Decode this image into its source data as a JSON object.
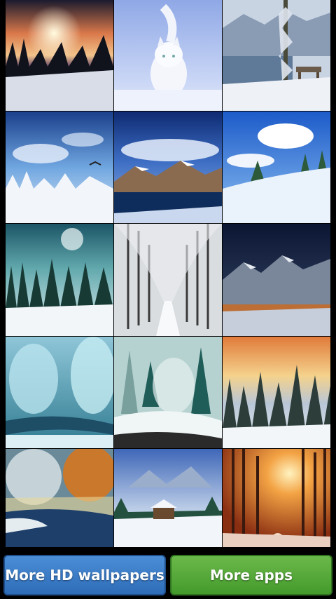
{
  "gallery": {
    "tiles": [
      {
        "subject": "winter-sunset-forest"
      },
      {
        "subject": "white-cat-in-snow"
      },
      {
        "subject": "lake-bench-snowy-trees"
      },
      {
        "subject": "snowy-forest-blue-sky-bird"
      },
      {
        "subject": "mountain-lake-clouds"
      },
      {
        "subject": "snowy-hill-clouds"
      },
      {
        "subject": "moon-over-snowy-forest"
      },
      {
        "subject": "snowy-tree-alley"
      },
      {
        "subject": "mountains-at-night"
      },
      {
        "subject": "frozen-river-trees"
      },
      {
        "subject": "snowy-pine-forest-teal"
      },
      {
        "subject": "sunrise-snowy-pines"
      },
      {
        "subject": "autumn-winter-stream"
      },
      {
        "subject": "cabin-in-snowy-valley"
      },
      {
        "subject": "orange-sun-snowy-forest"
      }
    ]
  },
  "buttons": {
    "more_wallpapers": "More HD wallpapers",
    "more_apps": "More apps"
  },
  "colors": {
    "background": "#000000",
    "more_wallpapers_button": "#3a7cc8",
    "more_apps_button": "#55a83a"
  }
}
